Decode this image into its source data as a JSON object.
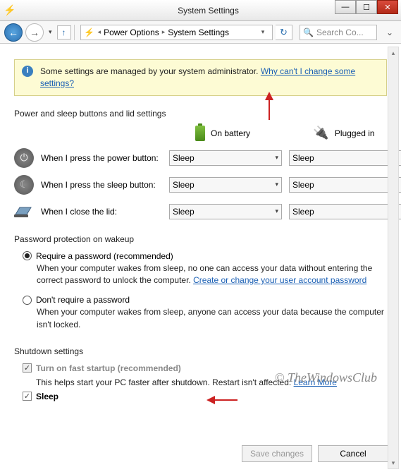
{
  "window": {
    "title": "System Settings"
  },
  "nav": {
    "breadcrumb": [
      "Power Options",
      "System Settings"
    ],
    "search_placeholder": "Search Co..."
  },
  "admin_banner": {
    "text": "Some settings are managed by your system administrator.",
    "link": "Why can't I change some settings?"
  },
  "sections": {
    "buttons_lid": {
      "title": "Power and sleep buttons and lid settings",
      "col_battery": "On battery",
      "col_plugged": "Plugged in",
      "rows": [
        {
          "label": "When I press the power button:",
          "battery": "Sleep",
          "plugged": "Sleep"
        },
        {
          "label": "When I press the sleep button:",
          "battery": "Sleep",
          "plugged": "Sleep"
        },
        {
          "label": "When I close the lid:",
          "battery": "Sleep",
          "plugged": "Sleep"
        }
      ]
    },
    "wakeup": {
      "title": "Password protection on wakeup",
      "require": {
        "label": "Require a password (recommended)",
        "desc": "When your computer wakes from sleep, no one can access your data without entering the correct password to unlock the computer.",
        "link": "Create or change your user account password"
      },
      "dont_require": {
        "label": "Don't require a password",
        "desc": "When your computer wakes from sleep, anyone can access your data because the computer isn't locked."
      }
    },
    "shutdown": {
      "title": "Shutdown settings",
      "fast_startup": {
        "label": "Turn on fast startup (recommended)",
        "desc": "This helps start your PC faster after shutdown. Restart isn't affected.",
        "link": "Learn More"
      },
      "sleep": {
        "label": "Sleep"
      }
    }
  },
  "footer": {
    "save": "Save changes",
    "cancel": "Cancel"
  },
  "watermark": "© TheWindowsClub"
}
